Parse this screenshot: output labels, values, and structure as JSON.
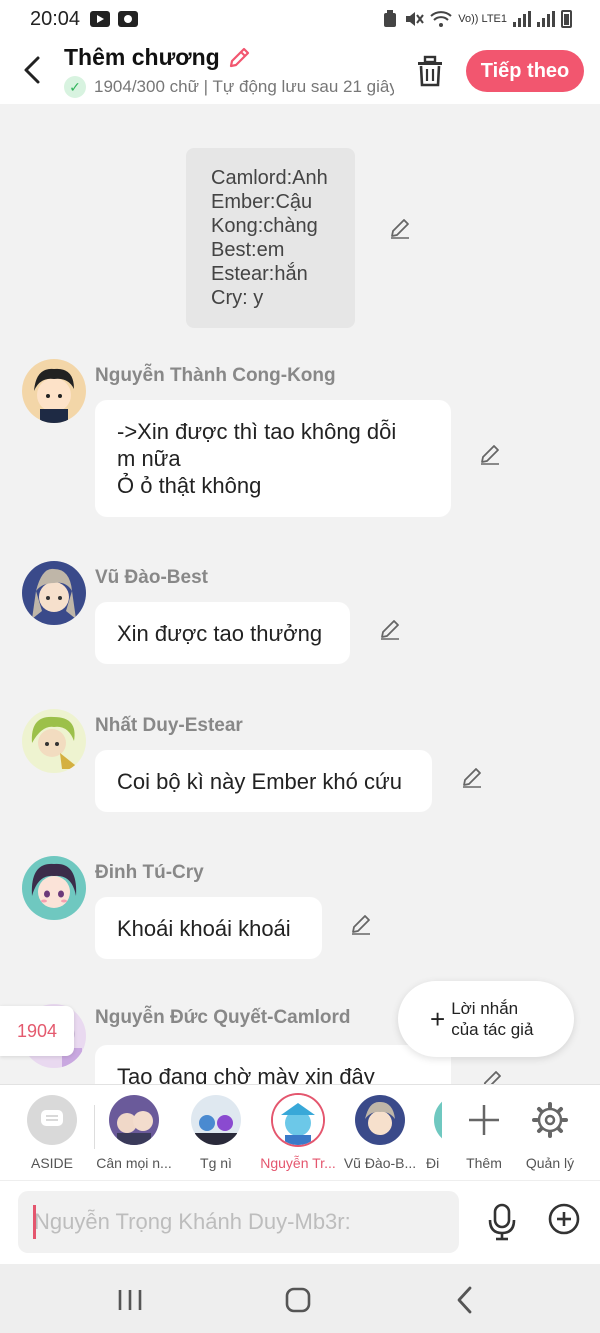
{
  "status_bar": {
    "time": "20:04",
    "network": "Vo)) LTE1"
  },
  "header": {
    "title": "Thêm chương",
    "subtitle": "1904/300 chữ | Tự động lưu sau 21 giây",
    "next_label": "Tiếp theo"
  },
  "note_card": {
    "lines": [
      "Camlord:Anh",
      "Ember:Cậu",
      "Kong:chàng",
      "Best:em",
      "Estear:hắn",
      "Cry: y"
    ]
  },
  "messages": [
    {
      "sender": "Nguyễn Thành Cong-Kong",
      "lines": [
        "->Xin được thì tao không dỗi",
        "m nữa",
        "Ỏ ỏ thật không"
      ]
    },
    {
      "sender": "Vũ Đào-Best",
      "lines": [
        "Xin được tao thưởng"
      ]
    },
    {
      "sender": "Nhất Duy-Estear",
      "lines": [
        "Coi bộ kì này Ember khó cứu"
      ]
    },
    {
      "sender": "Đinh Tú-Cry",
      "lines": [
        "Khoái khoái khoái"
      ]
    },
    {
      "sender": "Nguyễn Đức Quyết-Camlord",
      "lines": [
        "Tao đang chờ mày xin đây"
      ]
    }
  ],
  "page_count": "1904",
  "author_note": {
    "line1": "Lời nhắn",
    "line2": "của tác giả"
  },
  "characters": [
    {
      "name": "ASIDE"
    },
    {
      "name": "Cân mọi n..."
    },
    {
      "name": "Tg nì"
    },
    {
      "name": "Nguyễn Tr..."
    },
    {
      "name": "Vũ Đào-B..."
    },
    {
      "name": "Đi"
    }
  ],
  "actions": {
    "add_label": "Thêm",
    "manage_label": "Quản lý"
  },
  "input": {
    "placeholder": "Nguyễn Trọng Khánh Duy-Mb3r:"
  },
  "colors": {
    "accent": "#f2566f",
    "check": "#2fb35a",
    "background": "#f2f2f2"
  },
  "icons": [
    "back-arrow-icon",
    "pencil-icon",
    "check-icon",
    "trash-icon",
    "plus-icon",
    "gear-icon",
    "mic-icon",
    "plus-circle-icon",
    "recent-apps-icon",
    "home-icon",
    "back-nav-icon"
  ]
}
